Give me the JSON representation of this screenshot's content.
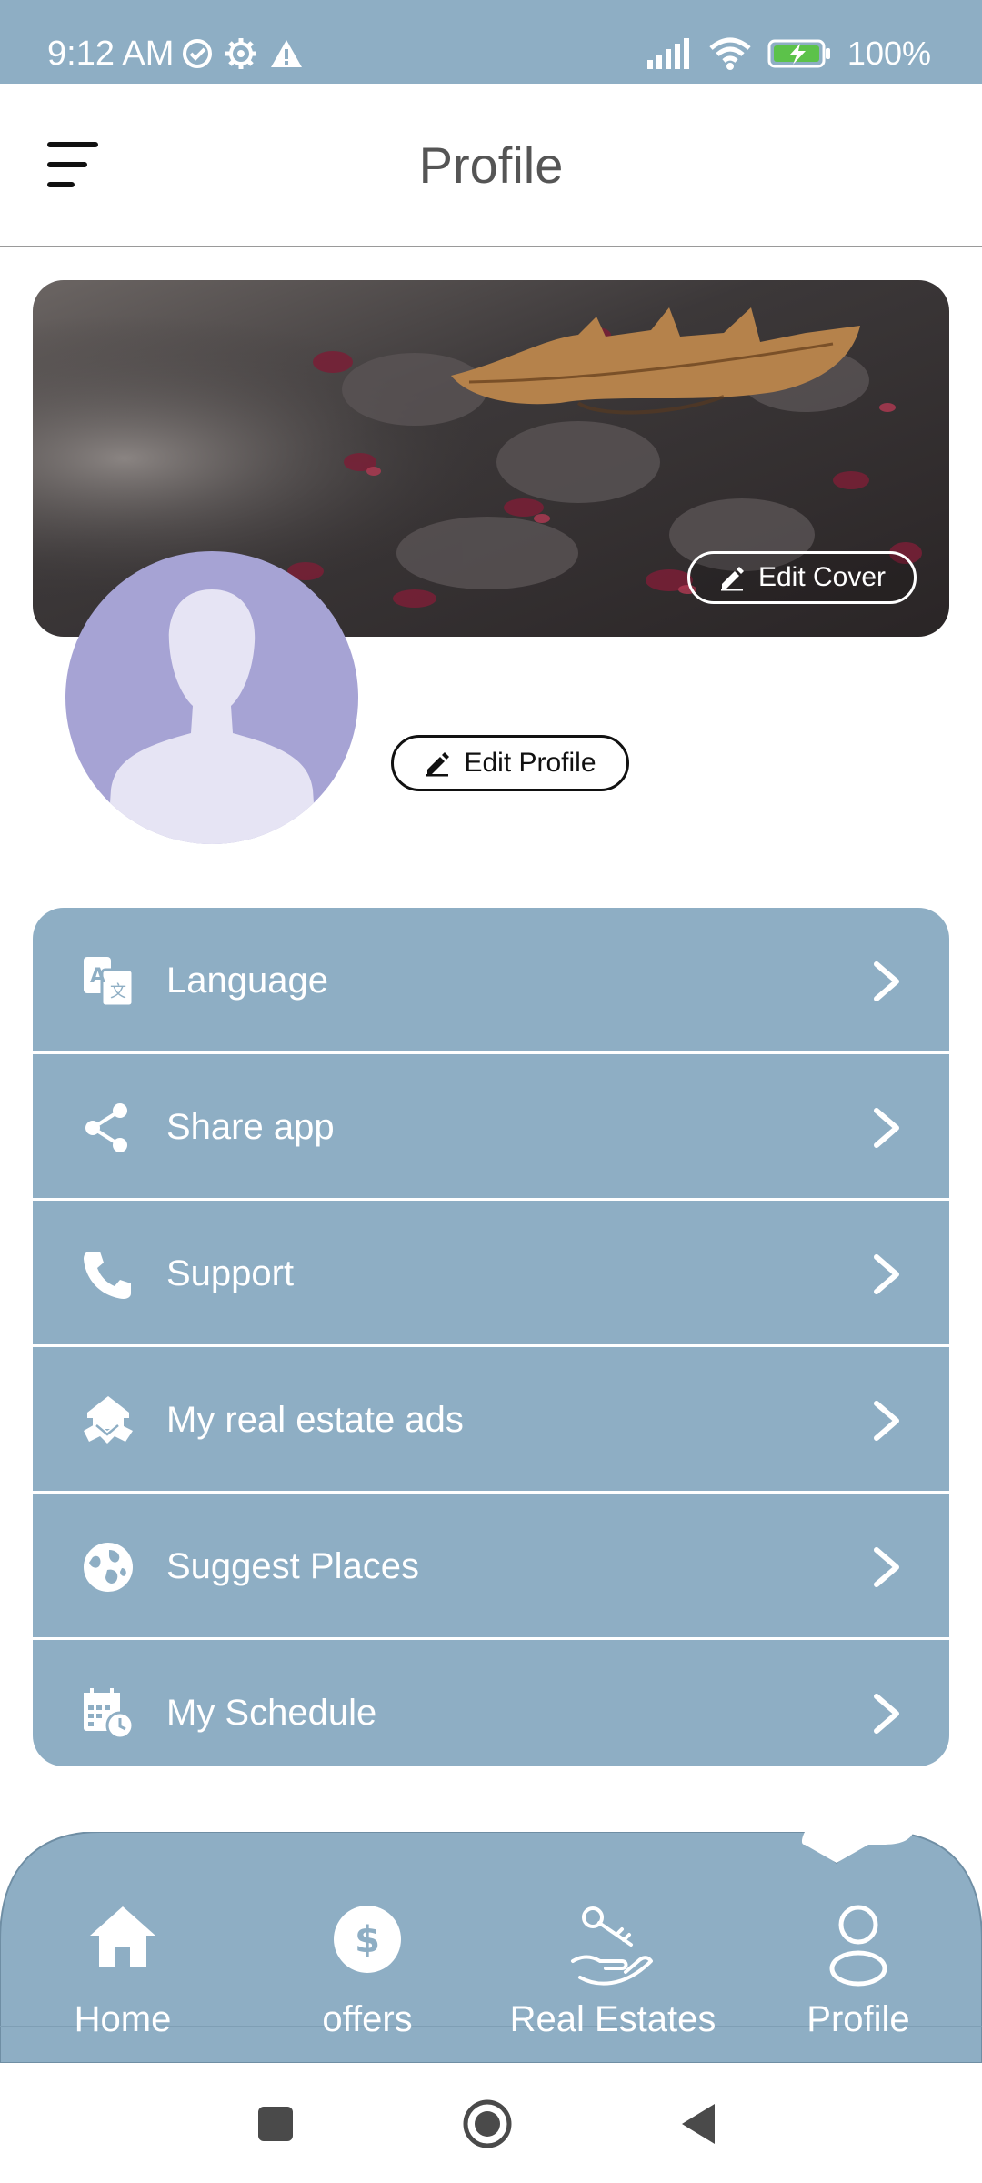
{
  "status_bar": {
    "time": "9:12 AM",
    "battery": "100%"
  },
  "header": {
    "title": "Profile"
  },
  "profile": {
    "edit_cover_label": "Edit Cover",
    "edit_profile_label": "Edit Profile"
  },
  "menu": {
    "items": [
      {
        "label": "Language",
        "icon": "translate-icon"
      },
      {
        "label": "Share app",
        "icon": "share-icon"
      },
      {
        "label": "Support",
        "icon": "phone-icon"
      },
      {
        "label": "My real estate ads",
        "icon": "handshake-house-icon"
      },
      {
        "label": "Suggest Places",
        "icon": "globe-icon"
      },
      {
        "label": "My Schedule",
        "icon": "calendar-clock-icon"
      }
    ]
  },
  "bottom_nav": {
    "items": [
      {
        "label": "Home",
        "icon": "home-icon"
      },
      {
        "label": "offers",
        "icon": "dollar-icon"
      },
      {
        "label": "Real Estates",
        "icon": "key-hand-icon"
      },
      {
        "label": "Profile",
        "icon": "person-icon",
        "active": true
      }
    ]
  },
  "colors": {
    "accent": "#8eaec4",
    "avatar_bg": "#a6a3d4",
    "avatar_silhouette": "#e6e4f4",
    "text_dark": "#111111",
    "title_gray": "#555555"
  }
}
